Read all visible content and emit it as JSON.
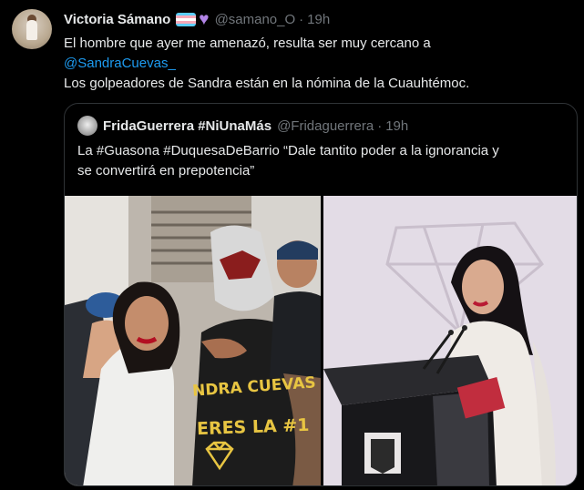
{
  "tweet": {
    "author_name": "Victoria Sámano",
    "handle": "@samano_O",
    "separator": "·",
    "time": "19h",
    "line1": "El hombre que ayer me amenazó, resulta ser muy cercano a",
    "mention": "@SandraCuevas_",
    "line3": "Los golpeadores de Sandra están en la nómina de la Cuauhtémoc."
  },
  "quote": {
    "author_name": "FridaGuerrera #NiUnaMás",
    "handle": "@Fridaguerrera",
    "separator": "·",
    "time": "19h",
    "line1": "La #Guasona #DuquesaDeBarrio “Dale tantito poder a la ignorancia y",
    "line2": "se convertirá en prepotencia”"
  },
  "media": {
    "shirt_line1": "NDRA CUEVAS",
    "shirt_line2": "ERES LA #1"
  },
  "icons": {
    "flag": "transgender-flag-icon",
    "heart": "purple-heart-icon"
  }
}
